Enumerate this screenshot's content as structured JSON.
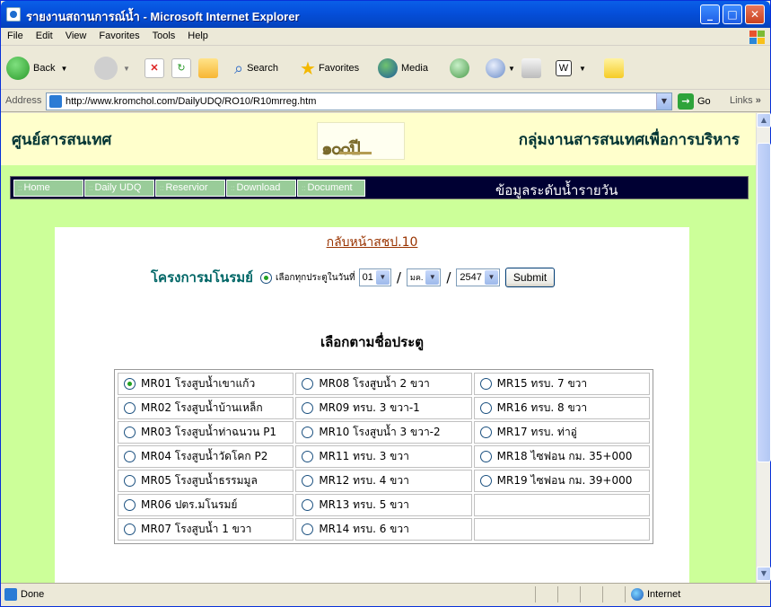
{
  "window": {
    "title": "รายงานสถานการณ์น้ำ - Microsoft Internet Explorer",
    "controls": [
      "minimize",
      "maximize",
      "close"
    ]
  },
  "menu": [
    "File",
    "Edit",
    "View",
    "Favorites",
    "Tools",
    "Help"
  ],
  "toolbar": {
    "back": "Back",
    "search": "Search",
    "favorites": "Favorites",
    "media": "Media"
  },
  "address": {
    "label": "Address",
    "url": "http://www.kromchol.com/DailyUDQ/RO10/R10mrreg.htm",
    "go": "Go",
    "links": "Links"
  },
  "site": {
    "left_title": "ศูนย์สารสนเทศ",
    "right_title": "กลุ่มงานสารสนเทศเพื่อการบริหาร",
    "logo_text": "๑๐๐ปี",
    "nav": [
      "Home",
      "Daily UDQ",
      "Reservior",
      "Download",
      "Document"
    ],
    "nav_title": "ข้อมูลระดับน้ำรายวัน"
  },
  "content": {
    "back_link": "กลับหน้าสชป.10",
    "project_name": "โครงการมโนรมย์",
    "all_gates_label": "เลือกทุกประตูในวันที่",
    "day": "01",
    "month": "มค.",
    "year": "2547",
    "submit": "Submit",
    "gate_heading": "เลือกตามชื่อประตู",
    "gates": [
      [
        "MR01 โรงสูบน้ำเขาแก้ว",
        "MR08 โรงสูบน้ำ 2 ขวา",
        "MR15 ทรบ. 7 ขวา"
      ],
      [
        "MR02 โรงสูบน้ำบ้านเหล็ก",
        "MR09 ทรบ. 3 ขวา-1",
        "MR16 ทรบ. 8 ขวา"
      ],
      [
        "MR03 โรงสูบน้ำท่าฉนวน P1",
        "MR10 โรงสูบน้ำ 3 ขวา-2",
        "MR17 ทรบ. ท่าอู่"
      ],
      [
        "MR04 โรงสูบน้ำวัดโคก P2",
        "MR11 ทรบ. 3 ขวา",
        "MR18 ไซฟอน กม. 35+000"
      ],
      [
        "MR05 โรงสูบน้ำธรรมมูล",
        "MR12 ทรบ. 4 ขวา",
        "MR19 ไซฟอน กม. 39+000"
      ],
      [
        "MR06 ปตร.มโนรมย์",
        "MR13 ทรบ. 5 ขวา",
        ""
      ],
      [
        "MR07 โรงสูบน้ำ 1 ขวา",
        "MR14 ทรบ. 6 ขวา",
        ""
      ]
    ],
    "selected_gate": "MR01 โรงสูบน้ำเขาแก้ว"
  },
  "status": {
    "text": "Done",
    "zone": "Internet"
  }
}
